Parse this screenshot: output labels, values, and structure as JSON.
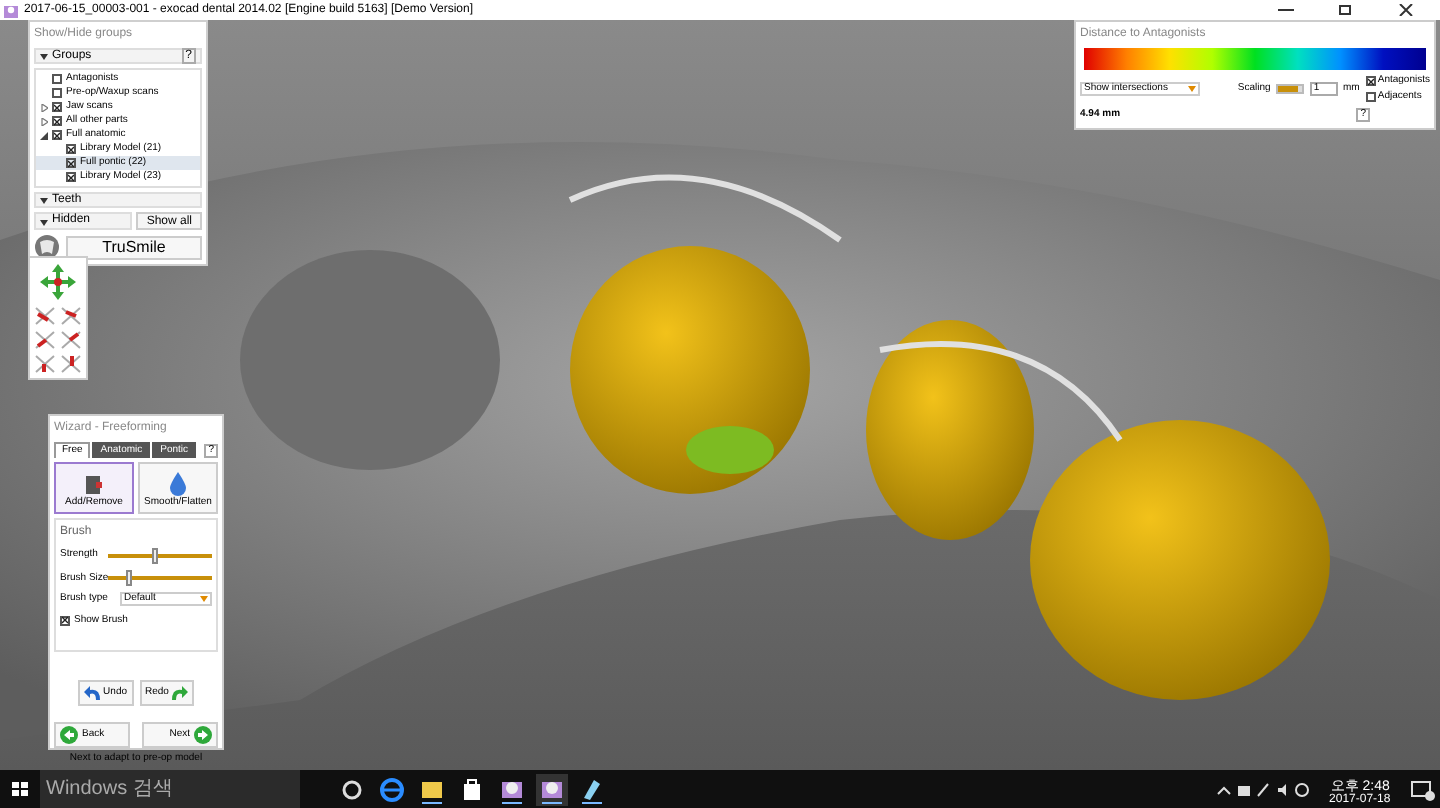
{
  "window": {
    "title": "2017-06-15_00003-001 - exocad dental 2014.02 [Engine build 5163] [Demo Version]"
  },
  "groups_panel": {
    "title": "Show/Hide groups",
    "groups_label": "Groups",
    "groups_expanded": true,
    "help": "?",
    "tree": [
      {
        "label": "Antagonists",
        "checked": false,
        "selected": false
      },
      {
        "label": "Pre-op/Waxup scans",
        "checked": false,
        "selected": false
      },
      {
        "label": "Jaw scans",
        "checked": true,
        "expanded": false,
        "selected": false
      },
      {
        "label": "All other parts",
        "checked": true,
        "expanded": false,
        "selected": false
      },
      {
        "label": "Full anatomic",
        "checked": true,
        "expanded": true,
        "selected": false,
        "children": [
          {
            "label": "Library Model (21)",
            "checked": true,
            "selected": false
          },
          {
            "label": "Full pontic (22)",
            "checked": true,
            "selected": true
          },
          {
            "label": "Library Model (23)",
            "checked": true,
            "selected": false
          }
        ]
      }
    ],
    "teeth_label": "Teeth",
    "hidden_label": "Hidden",
    "show_all": "Show all",
    "trusmile": "TruSmile"
  },
  "wizard": {
    "title": "Wizard - Freeforming",
    "tabs": [
      {
        "label": "Free",
        "selected": true
      },
      {
        "label": "Anatomic",
        "selected": false
      },
      {
        "label": "Pontic",
        "selected": false
      }
    ],
    "help": "?",
    "tools": [
      {
        "label": "Add/Remove",
        "selected": true
      },
      {
        "label": "Smooth/Flatten",
        "selected": false
      }
    ],
    "brush_label": "Brush",
    "sliders": [
      {
        "label": "Strength",
        "level": 0.45
      },
      {
        "label": "Brush Size",
        "level": 0.2
      }
    ],
    "brush_type_label": "Brush type",
    "brush_type": "Default",
    "show_brush": {
      "label": "Show Brush",
      "checked": true
    },
    "undo": "Undo",
    "redo": "Redo",
    "back": "Back",
    "next": "Next",
    "hint": "Next to adapt to pre-op model"
  },
  "distance_panel": {
    "title": "Distance to Antagonists",
    "mode": "Show intersections",
    "scaling_label": "Scaling",
    "scaling_slider": {
      "level": 0.8
    },
    "scaling_value": "1",
    "unit": "mm",
    "options": [
      {
        "label": "Antagonists",
        "checked": true
      },
      {
        "label": "Adjacents",
        "checked": false
      }
    ],
    "reading": "4.94 mm",
    "help": "?"
  },
  "taskbar": {
    "search_placeholder": "Windows 검색",
    "time": "오후 2:48",
    "date": "2017-07-18"
  }
}
